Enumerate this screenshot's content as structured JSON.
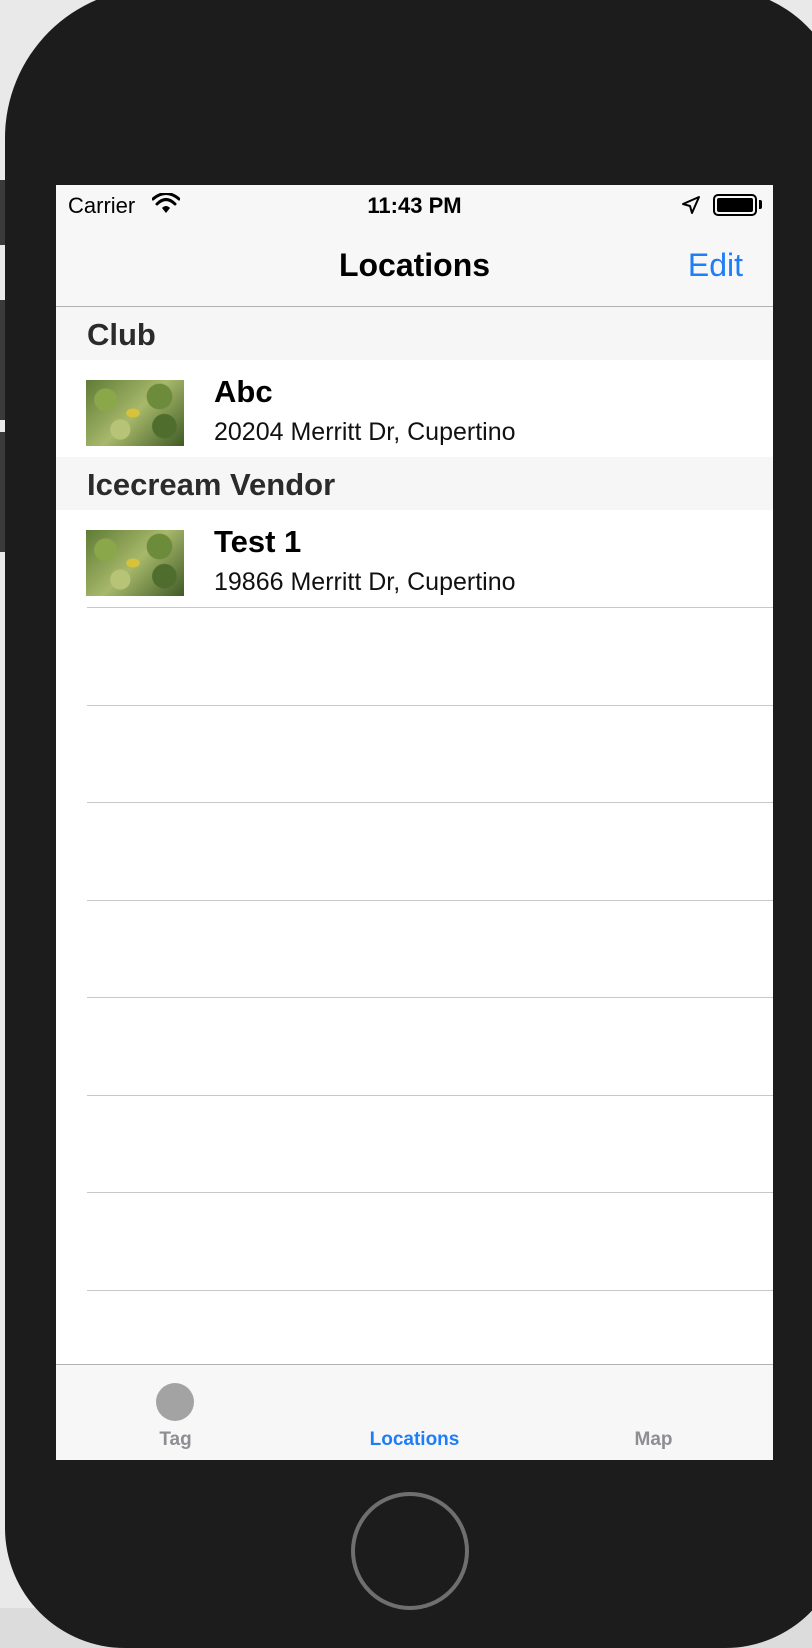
{
  "status_bar": {
    "carrier": "Carrier",
    "time": "11:43 PM",
    "icons": [
      "wifi-icon",
      "location-arrow-icon",
      "battery-icon"
    ]
  },
  "nav_bar": {
    "title": "Locations",
    "edit_label": "Edit"
  },
  "sections": [
    {
      "title": "Club",
      "rows": [
        {
          "title": "Abc",
          "subtitle": "20204 Merritt Dr, Cupertino"
        }
      ]
    },
    {
      "title": "Icecream Vendor",
      "rows": [
        {
          "title": "Test 1",
          "subtitle": "19866 Merritt Dr, Cupertino"
        }
      ]
    }
  ],
  "tab_bar": {
    "tabs": [
      {
        "label": "Tag",
        "icon": "circle-icon",
        "active": false
      },
      {
        "label": "Locations",
        "active": true
      },
      {
        "label": "Map",
        "active": false
      }
    ]
  },
  "colors": {
    "tint": "#1e7ef7",
    "inactive_tab": "#8e8e93",
    "device_bezel": "#1c1c1c"
  }
}
